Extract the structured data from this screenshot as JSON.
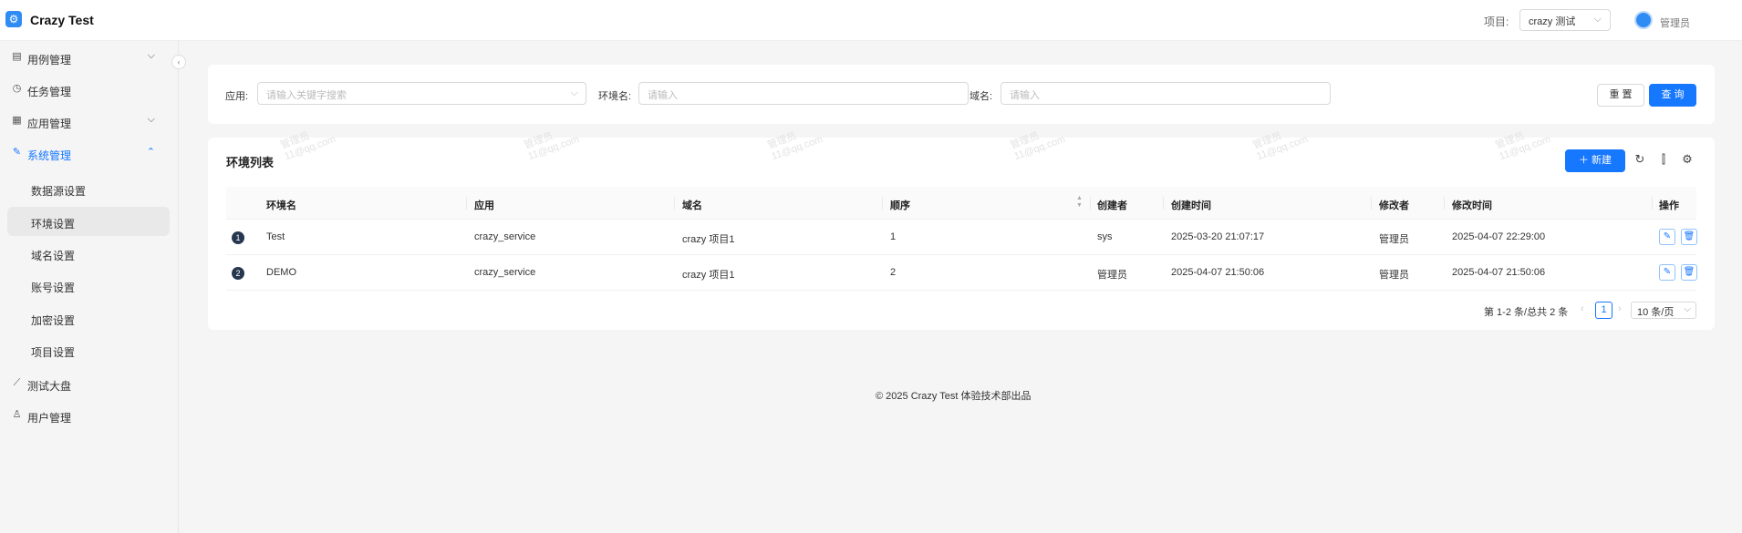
{
  "header": {
    "app_title": "Crazy Test",
    "project_label": "项目:",
    "project_value": "crazy 测试",
    "user_name": "管理员"
  },
  "sidebar": {
    "items": [
      {
        "label": "用例管理",
        "icon": "file-icon",
        "expanded": false
      },
      {
        "label": "任务管理",
        "icon": "clock-icon"
      },
      {
        "label": "应用管理",
        "icon": "grid-icon",
        "expanded": false
      },
      {
        "label": "系统管理",
        "icon": "wrench-icon",
        "expanded": true,
        "active": true
      },
      {
        "label": "测试大盘",
        "icon": "chart-icon"
      },
      {
        "label": "用户管理",
        "icon": "user-icon"
      }
    ],
    "sub_items": [
      "数据源设置",
      "环境设置",
      "域名设置",
      "账号设置",
      "加密设置",
      "项目设置"
    ],
    "selected_sub": "环境设置"
  },
  "search": {
    "app_label": "应用:",
    "app_placeholder": "请输入关键字搜索",
    "env_label": "环境名:",
    "env_placeholder": "请输入",
    "domain_label": "域名:",
    "domain_placeholder": "请输入",
    "reset_label": "重 置",
    "query_label": "查 询"
  },
  "table": {
    "title": "环境列表",
    "new_label": "新建",
    "columns": [
      "环境名",
      "应用",
      "域名",
      "顺序",
      "创建者",
      "创建时间",
      "修改者",
      "修改时间",
      "操作"
    ],
    "rows": [
      {
        "index": "1",
        "name": "Test",
        "app": "crazy_service",
        "domain": "crazy 项目1",
        "order": "1",
        "creator": "sys",
        "created": "2025-03-20 21:07:17",
        "modifier": "管理员",
        "modified": "2025-04-07 22:29:00"
      },
      {
        "index": "2",
        "name": "DEMO",
        "app": "crazy_service",
        "domain": "crazy 项目1",
        "order": "2",
        "creator": "管理员",
        "created": "2025-04-07 21:50:06",
        "modifier": "管理员",
        "modified": "2025-04-07 21:50:06"
      }
    ]
  },
  "pagination": {
    "total_text": "第 1-2 条/总共 2 条",
    "current_page": "1",
    "page_size": "10 条/页"
  },
  "footer": {
    "text": "© 2025 Crazy Test 体验技术部出品"
  },
  "watermark": {
    "line1": "管理员",
    "line2": "11@qq.com"
  },
  "colors": {
    "primary": "#1677ff",
    "row_badge": "#26374f"
  }
}
